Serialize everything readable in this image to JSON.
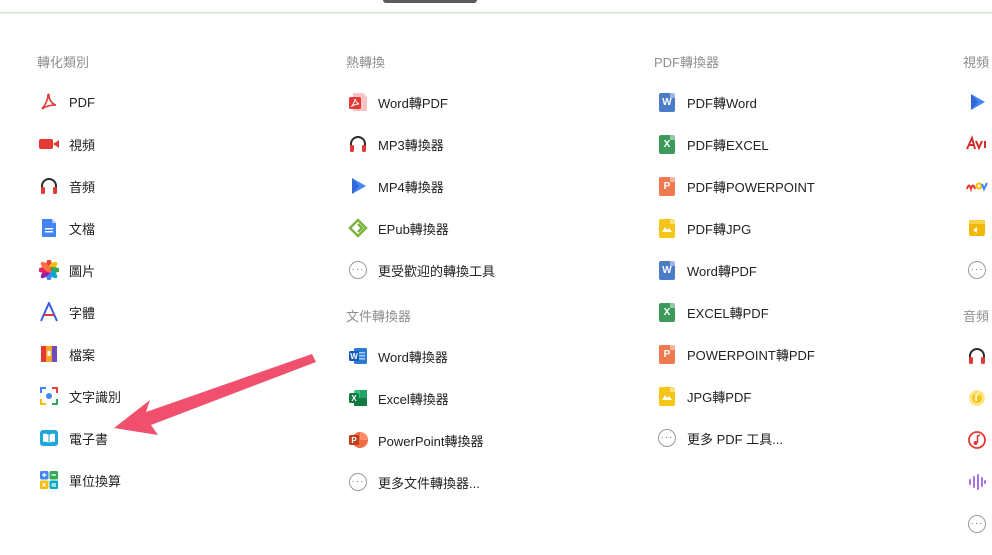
{
  "columns": [
    {
      "heading": "轉化類別",
      "items": [
        {
          "label": "PDF",
          "icon": "pdf-acrobat-icon"
        },
        {
          "label": "視頻",
          "icon": "video-camera-icon"
        },
        {
          "label": "音頻",
          "icon": "headphones-icon"
        },
        {
          "label": "文檔",
          "icon": "document-icon"
        },
        {
          "label": "圖片",
          "icon": "photos-pinwheel-icon"
        },
        {
          "label": "字體",
          "icon": "font-icon"
        },
        {
          "label": "檔案",
          "icon": "archive-icon"
        },
        {
          "label": "文字識別",
          "icon": "ocr-lens-icon"
        },
        {
          "label": "電子書",
          "icon": "ebook-icon"
        },
        {
          "label": "單位換算",
          "icon": "calculator-icon"
        }
      ]
    },
    {
      "heading": "熱轉換",
      "items": [
        {
          "label": "Word轉PDF",
          "icon": "pdf-icon"
        },
        {
          "label": "MP3轉換器",
          "icon": "headphones-icon"
        },
        {
          "label": "MP4轉換器",
          "icon": "play-icon"
        },
        {
          "label": "EPub轉換器",
          "icon": "epub-icon"
        },
        {
          "label": "更受歡迎的轉換工具",
          "icon": "more-icon"
        }
      ],
      "heading2": "文件轉換器",
      "items2": [
        {
          "label": "Word轉換器",
          "icon": "word-icon"
        },
        {
          "label": "Excel轉換器",
          "icon": "excel-icon"
        },
        {
          "label": "PowerPoint轉換器",
          "icon": "powerpoint-icon"
        },
        {
          "label": "更多文件轉換器...",
          "icon": "more-icon"
        }
      ]
    },
    {
      "heading": "PDF轉換器",
      "items": [
        {
          "label": "PDF轉Word",
          "icon": "word-doc-icon"
        },
        {
          "label": "PDF轉EXCEL",
          "icon": "excel-doc-icon"
        },
        {
          "label": "PDF轉POWERPOINT",
          "icon": "powerpoint-doc-icon"
        },
        {
          "label": "PDF轉JPG",
          "icon": "image-doc-icon"
        },
        {
          "label": "Word轉PDF",
          "icon": "word-doc-icon"
        },
        {
          "label": "EXCEL轉PDF",
          "icon": "excel-doc-icon"
        },
        {
          "label": "POWERPOINT轉PDF",
          "icon": "powerpoint-doc-icon"
        },
        {
          "label": "JPG轉PDF",
          "icon": "image-doc-icon"
        },
        {
          "label": "更多 PDF 工具...",
          "icon": "more-icon"
        }
      ]
    },
    {
      "heading": "視頻",
      "heading2": "音頻"
    }
  ],
  "colors": {
    "pdf_red": "#e53935",
    "word_blue": "#4a7cc7",
    "excel_green": "#3e9a5a",
    "ppt_orange": "#f07a4f",
    "jpg_yellow": "#f5c518",
    "arrow": "#f0506e"
  }
}
